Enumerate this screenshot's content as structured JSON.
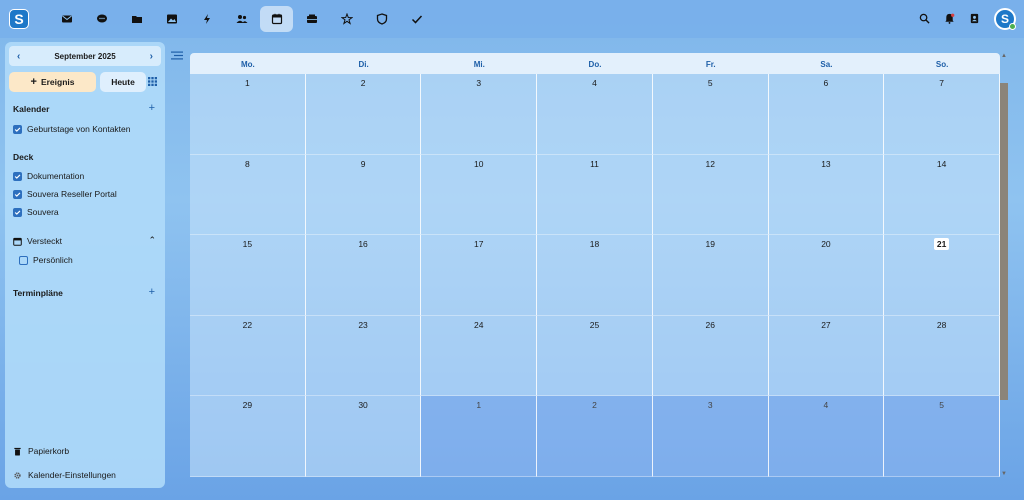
{
  "topbar": {
    "logo_letter": "S",
    "apps": [
      {
        "icon": "mail-icon"
      },
      {
        "icon": "talk-icon"
      },
      {
        "icon": "files-icon"
      },
      {
        "icon": "photos-icon"
      },
      {
        "icon": "activity-icon"
      },
      {
        "icon": "contacts-icon"
      },
      {
        "icon": "calendar-icon",
        "active": true
      },
      {
        "icon": "deck-icon"
      },
      {
        "icon": "favorites-icon"
      },
      {
        "icon": "shield-icon"
      },
      {
        "icon": "tasks-icon"
      }
    ],
    "avatar_letter": "S"
  },
  "sidebar": {
    "month_label": "September 2025",
    "new_event_label": "Ereignis",
    "today_label": "Heute",
    "calendars_title": "Kalender",
    "calendars": [
      {
        "label": "Geburtstage von Kontakten",
        "checked": true
      }
    ],
    "deck_title": "Deck",
    "deck_items": [
      {
        "label": "Dokumentation",
        "checked": true
      },
      {
        "label": "Souvera Reseller Portal",
        "checked": true
      },
      {
        "label": "Souvera",
        "checked": true
      }
    ],
    "hidden_title": "Versteckt",
    "hidden_items": [
      {
        "label": "Persönlich",
        "checked": false
      }
    ],
    "appointments_title": "Terminpläne",
    "trash_label": "Papierkorb",
    "settings_label": "Kalender-Einstellungen"
  },
  "calendar": {
    "weekdays": [
      "Mo.",
      "Di.",
      "Mi.",
      "Do.",
      "Fr.",
      "Sa.",
      "So."
    ],
    "weeks": [
      [
        "1",
        "2",
        "3",
        "4",
        "5",
        "6",
        "7"
      ],
      [
        "8",
        "9",
        "10",
        "11",
        "12",
        "13",
        "14"
      ],
      [
        "15",
        "16",
        "17",
        "18",
        "19",
        "20",
        "21"
      ],
      [
        "22",
        "23",
        "24",
        "25",
        "26",
        "27",
        "28"
      ],
      [
        "29",
        "30",
        "1",
        "2",
        "3",
        "4",
        "5"
      ]
    ],
    "today": "21"
  }
}
